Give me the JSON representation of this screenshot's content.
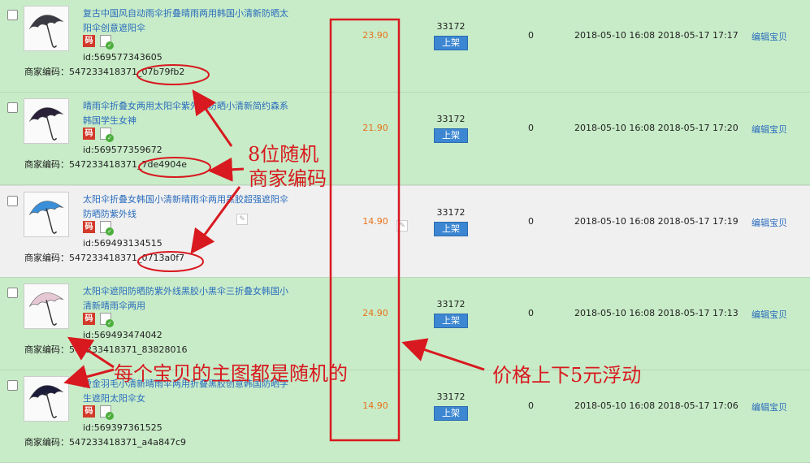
{
  "items": [
    {
      "title": "复古中国风自动雨伞折叠晴雨两用韩国小清新防晒太阳伞创意遮阳伞",
      "badge": "码",
      "id": "id:569577343605",
      "code": "商家编码：547233418371_07b79fb2",
      "price": "23.90",
      "stock": "33172",
      "shelf_label": "上架",
      "sold": "0",
      "time": "2018-05-10 16:08 2018-05-17 17:17",
      "edit": "编辑宝贝",
      "thumb_color": "#3a3a44"
    },
    {
      "title": "晴雨伞折叠女两用太阳伞紫外线防晒小清新简约森系韩国学生女神",
      "badge": "码",
      "id": "id:569577359672",
      "code": "商家编码：547233418371_7de4904e",
      "price": "21.90",
      "stock": "33172",
      "shelf_label": "上架",
      "sold": "0",
      "time": "2018-05-10 16:08 2018-05-17 17:20",
      "edit": "编辑宝贝",
      "thumb_color": "#2a2038"
    },
    {
      "title": "太阳伞折叠女韩国小清新晴雨伞两用黑胶超强遮阳伞防晒防紫外线",
      "badge": "码",
      "id": "id:569493134515",
      "code": "商家编码：547233418371_0713a0f7",
      "price": "14.90",
      "stock": "33172",
      "shelf_label": "上架",
      "sold": "0",
      "time": "2018-05-10 16:08 2018-05-17 17:19",
      "edit": "编辑宝贝",
      "thumb_color": "#3a8fd8"
    },
    {
      "title": "太阳伞遮阳防晒防紫外线黑胶小黑伞三折叠女韩国小清新晴雨伞两用",
      "badge": "码",
      "id": "id:569493474042",
      "code": "商家编码：547233418371_83828016",
      "price": "24.90",
      "stock": "33172",
      "shelf_label": "上架",
      "sold": "0",
      "time": "2018-05-10 16:08 2018-05-17 17:13",
      "edit": "编辑宝贝",
      "thumb_color": "#e6c8d4"
    },
    {
      "title": "烫金羽毛小清新晴雨伞两用折叠黑胶创意韩国防晒学生遮阳太阳伞女",
      "badge": "码",
      "id": "id:569397361525",
      "code": "商家编码：547233418371_a4a847c9",
      "price": "14.90",
      "stock": "33172",
      "shelf_label": "上架",
      "sold": "0",
      "time": "2018-05-10 16:08 2018-05-17 17:06",
      "edit": "编辑宝贝",
      "thumb_color": "#1c1c3a"
    }
  ],
  "annotations": {
    "random_code_line1": "8位随机",
    "random_code_line2": "商家编码",
    "random_image": "每个宝贝的主图都是随机的",
    "price_float": "价格上下5元浮动"
  },
  "colors": {
    "annotation": "#d8191f",
    "row_bg": "#c8ecc8",
    "link": "#2a6cbd",
    "price": "#e8721a",
    "button": "#3d87d2"
  }
}
